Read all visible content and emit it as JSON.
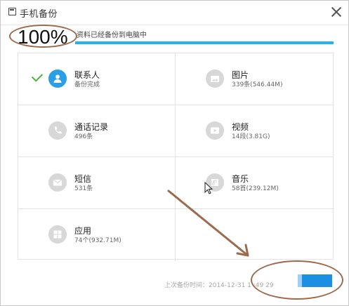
{
  "window": {
    "title": "手机备份",
    "close_icon": "close-icon"
  },
  "progress": {
    "percent_label": "100%",
    "status_text": "资料已经备份到电脑中",
    "fill_fraction": 1.0,
    "accent_color": "#23b4ef"
  },
  "items": {
    "contacts": {
      "label": "联系人",
      "sub": "备份完成",
      "icon": "user-icon",
      "done": true
    },
    "photos": {
      "label": "图片",
      "sub": "339条(546.44M)",
      "icon": "photo-icon"
    },
    "calls": {
      "label": "通话记录",
      "sub": "496条",
      "icon": "phone-icon"
    },
    "videos": {
      "label": "视频",
      "sub": "14段(3.81G)",
      "icon": "video-icon"
    },
    "sms": {
      "label": "短信",
      "sub": "531条",
      "icon": "message-icon"
    },
    "music": {
      "label": "音乐",
      "sub": "58首(239.12M)",
      "icon": "music-icon"
    },
    "apps": {
      "label": "应用",
      "sub": "74个(932.71M)",
      "icon": "apps-icon"
    }
  },
  "footer": {
    "last_backup_text": "上次备份时间：2014-12-31 1 :49 29"
  },
  "colors": {
    "done_check": "#4cb43a",
    "active_icon": "#2a9fe6",
    "annotation": "#9c6a4c",
    "button": "#1c8fe3"
  }
}
